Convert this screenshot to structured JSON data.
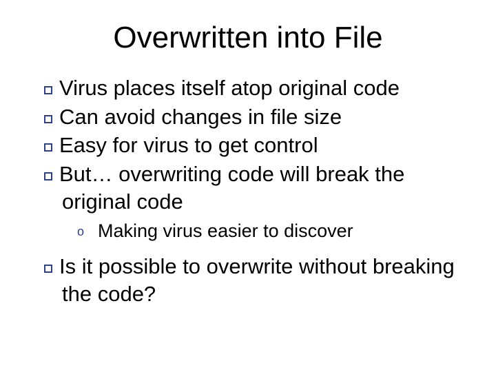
{
  "title": "Overwritten into File",
  "bullets": {
    "b1": "Virus places itself atop original code",
    "b2": "Can avoid changes in file size",
    "b3": "Easy for virus to get control",
    "b4": "But… overwriting code will break the original code",
    "b4_sub1": "Making virus easier to discover",
    "b5": "Is it possible to overwrite without breaking the code?"
  }
}
